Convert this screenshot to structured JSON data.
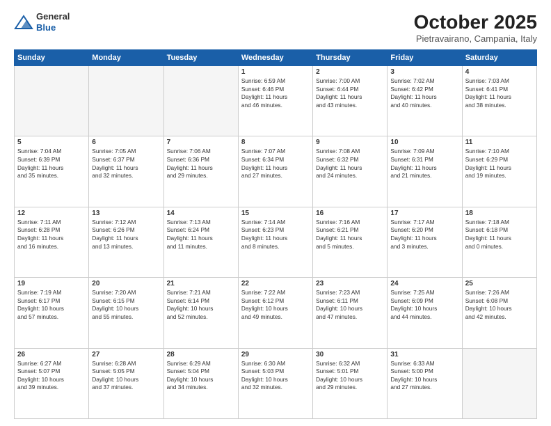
{
  "logo": {
    "general": "General",
    "blue": "Blue"
  },
  "title": "October 2025",
  "subtitle": "Pietravairano, Campania, Italy",
  "weekdays": [
    "Sunday",
    "Monday",
    "Tuesday",
    "Wednesday",
    "Thursday",
    "Friday",
    "Saturday"
  ],
  "weeks": [
    [
      {
        "day": "",
        "info": ""
      },
      {
        "day": "",
        "info": ""
      },
      {
        "day": "",
        "info": ""
      },
      {
        "day": "1",
        "info": "Sunrise: 6:59 AM\nSunset: 6:46 PM\nDaylight: 11 hours\nand 46 minutes."
      },
      {
        "day": "2",
        "info": "Sunrise: 7:00 AM\nSunset: 6:44 PM\nDaylight: 11 hours\nand 43 minutes."
      },
      {
        "day": "3",
        "info": "Sunrise: 7:02 AM\nSunset: 6:42 PM\nDaylight: 11 hours\nand 40 minutes."
      },
      {
        "day": "4",
        "info": "Sunrise: 7:03 AM\nSunset: 6:41 PM\nDaylight: 11 hours\nand 38 minutes."
      }
    ],
    [
      {
        "day": "5",
        "info": "Sunrise: 7:04 AM\nSunset: 6:39 PM\nDaylight: 11 hours\nand 35 minutes."
      },
      {
        "day": "6",
        "info": "Sunrise: 7:05 AM\nSunset: 6:37 PM\nDaylight: 11 hours\nand 32 minutes."
      },
      {
        "day": "7",
        "info": "Sunrise: 7:06 AM\nSunset: 6:36 PM\nDaylight: 11 hours\nand 29 minutes."
      },
      {
        "day": "8",
        "info": "Sunrise: 7:07 AM\nSunset: 6:34 PM\nDaylight: 11 hours\nand 27 minutes."
      },
      {
        "day": "9",
        "info": "Sunrise: 7:08 AM\nSunset: 6:32 PM\nDaylight: 11 hours\nand 24 minutes."
      },
      {
        "day": "10",
        "info": "Sunrise: 7:09 AM\nSunset: 6:31 PM\nDaylight: 11 hours\nand 21 minutes."
      },
      {
        "day": "11",
        "info": "Sunrise: 7:10 AM\nSunset: 6:29 PM\nDaylight: 11 hours\nand 19 minutes."
      }
    ],
    [
      {
        "day": "12",
        "info": "Sunrise: 7:11 AM\nSunset: 6:28 PM\nDaylight: 11 hours\nand 16 minutes."
      },
      {
        "day": "13",
        "info": "Sunrise: 7:12 AM\nSunset: 6:26 PM\nDaylight: 11 hours\nand 13 minutes."
      },
      {
        "day": "14",
        "info": "Sunrise: 7:13 AM\nSunset: 6:24 PM\nDaylight: 11 hours\nand 11 minutes."
      },
      {
        "day": "15",
        "info": "Sunrise: 7:14 AM\nSunset: 6:23 PM\nDaylight: 11 hours\nand 8 minutes."
      },
      {
        "day": "16",
        "info": "Sunrise: 7:16 AM\nSunset: 6:21 PM\nDaylight: 11 hours\nand 5 minutes."
      },
      {
        "day": "17",
        "info": "Sunrise: 7:17 AM\nSunset: 6:20 PM\nDaylight: 11 hours\nand 3 minutes."
      },
      {
        "day": "18",
        "info": "Sunrise: 7:18 AM\nSunset: 6:18 PM\nDaylight: 11 hours\nand 0 minutes."
      }
    ],
    [
      {
        "day": "19",
        "info": "Sunrise: 7:19 AM\nSunset: 6:17 PM\nDaylight: 10 hours\nand 57 minutes."
      },
      {
        "day": "20",
        "info": "Sunrise: 7:20 AM\nSunset: 6:15 PM\nDaylight: 10 hours\nand 55 minutes."
      },
      {
        "day": "21",
        "info": "Sunrise: 7:21 AM\nSunset: 6:14 PM\nDaylight: 10 hours\nand 52 minutes."
      },
      {
        "day": "22",
        "info": "Sunrise: 7:22 AM\nSunset: 6:12 PM\nDaylight: 10 hours\nand 49 minutes."
      },
      {
        "day": "23",
        "info": "Sunrise: 7:23 AM\nSunset: 6:11 PM\nDaylight: 10 hours\nand 47 minutes."
      },
      {
        "day": "24",
        "info": "Sunrise: 7:25 AM\nSunset: 6:09 PM\nDaylight: 10 hours\nand 44 minutes."
      },
      {
        "day": "25",
        "info": "Sunrise: 7:26 AM\nSunset: 6:08 PM\nDaylight: 10 hours\nand 42 minutes."
      }
    ],
    [
      {
        "day": "26",
        "info": "Sunrise: 6:27 AM\nSunset: 5:07 PM\nDaylight: 10 hours\nand 39 minutes."
      },
      {
        "day": "27",
        "info": "Sunrise: 6:28 AM\nSunset: 5:05 PM\nDaylight: 10 hours\nand 37 minutes."
      },
      {
        "day": "28",
        "info": "Sunrise: 6:29 AM\nSunset: 5:04 PM\nDaylight: 10 hours\nand 34 minutes."
      },
      {
        "day": "29",
        "info": "Sunrise: 6:30 AM\nSunset: 5:03 PM\nDaylight: 10 hours\nand 32 minutes."
      },
      {
        "day": "30",
        "info": "Sunrise: 6:32 AM\nSunset: 5:01 PM\nDaylight: 10 hours\nand 29 minutes."
      },
      {
        "day": "31",
        "info": "Sunrise: 6:33 AM\nSunset: 5:00 PM\nDaylight: 10 hours\nand 27 minutes."
      },
      {
        "day": "",
        "info": ""
      }
    ]
  ]
}
